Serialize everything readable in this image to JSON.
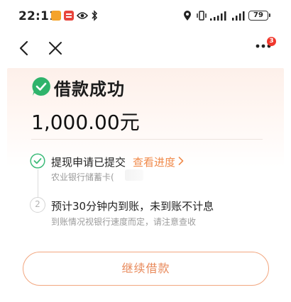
{
  "status_bar": {
    "time": "22:11",
    "battery": "79",
    "icons": [
      "app-orange-icon",
      "app-red-icon",
      "eye-icon",
      "bluetooth-icon",
      "location-icon",
      "vibrate-icon",
      "signal-icon",
      "signal-icon",
      "battery-icon"
    ]
  },
  "nav": {
    "badge_count": "3",
    "icons": [
      "chevron-left-icon",
      "close-icon",
      "more-icon"
    ]
  },
  "result": {
    "title": "借款成功",
    "amount": "1,000.00元"
  },
  "steps": [
    {
      "label": "提现申请已提交",
      "link_label": "查看进度",
      "sub": "农业银行储蓄卡("
    },
    {
      "number": "2",
      "label": "预计30分钟内到账，未到账不计息",
      "sub": "到账情况视银行速度而定，请注意查收"
    }
  ],
  "actions": {
    "continue_label": "继续借款"
  },
  "colors": {
    "accent": "#f08a4b",
    "success": "#2fb36b",
    "card_top": "#fdf0ea"
  }
}
